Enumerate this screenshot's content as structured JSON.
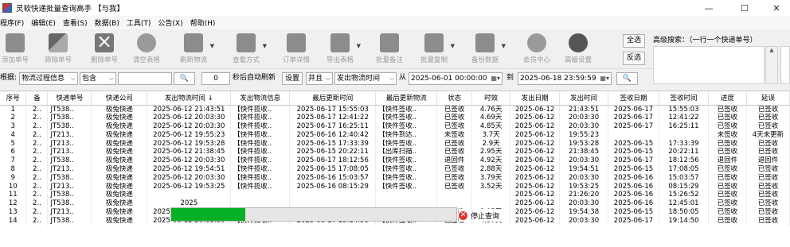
{
  "window": {
    "title": "灵软快递批量查询高手 【与我】",
    "min": "—",
    "max": "☐",
    "close": "✕"
  },
  "menu": [
    "程序(F)",
    "编辑(E)",
    "查看(S)",
    "数据(B)",
    "工具(T)",
    "公告(X)",
    "帮助(H)"
  ],
  "toolbar": {
    "add": "添加单号",
    "search_no": "筛除单号",
    "delete": "删除单号",
    "clear": "清空表格",
    "refresh": "刷新物流",
    "view": "查看方式",
    "detail": "订单详情",
    "export": "导出表格",
    "remark": "批量备注",
    "copy": "批量复制",
    "backup": "备份数据",
    "member": "会员中心",
    "settings": "高级设置"
  },
  "side": {
    "select_all": "全选",
    "invert": "反选"
  },
  "advanced": {
    "label": "高级搜索：（一行一个快递单号）",
    "scroll_up": "▲"
  },
  "filter": {
    "basis_label": "根据:",
    "basis": "物流过程信息",
    "mode": "包含",
    "keyword": "",
    "search_icon": "🔍",
    "interval": "0",
    "auto_label": "秒后自动刷新",
    "set": "设置",
    "logic": "并且",
    "time_field": "发出物流时间",
    "from": "从",
    "start": "2025-06-01 00:00:00",
    "to": "到",
    "end": "2025-06-18 23:59:59",
    "go_icon": "🔍"
  },
  "columns": [
    "序号",
    "备",
    "快递单号",
    "快递公司",
    "发出物流时间 ↓",
    "发出物流信息",
    "最后更新时间",
    "最后更新物流",
    "状态",
    "时效",
    "发出日期",
    "发出时间",
    "签收日期",
    "签收时间",
    "进度",
    "延误"
  ],
  "rows": [
    [
      "1",
      "2..",
      "JT538..",
      "极兔快递",
      "2025-06-12 21:43:51",
      "【快件揽收..",
      "2025-06-17 15:55:03",
      "【快件签收..",
      "已签收",
      "4.76天",
      "2025-06-12",
      "21:43:51",
      "2025-06-17",
      "15:55:03",
      "已签收",
      "已签收"
    ],
    [
      "2",
      "2..",
      "JT538..",
      "极兔快递",
      "2025-06-12 20:03:30",
      "【快件揽收..",
      "2025-06-17 12:41:22",
      "【快件签收..",
      "已签收",
      "4.69天",
      "2025-06-12",
      "20:03:30",
      "2025-06-17",
      "12:41:22",
      "已签收",
      "已签收"
    ],
    [
      "3",
      "2..",
      "JT538..",
      "极兔快递",
      "2025-06-12 20:03:30",
      "【快件揽收..",
      "2025-06-17 16:25:11",
      "【快件签收..",
      "已签收",
      "4.85天",
      "2025-06-12",
      "20:03:30",
      "2025-06-17",
      "16:25:11",
      "已签收",
      "已签收"
    ],
    [
      "4",
      "2..",
      "JT213..",
      "极兔快递",
      "2025-06-12 19:55:23",
      "【快件揽收..",
      "2025-06-16 12:40:42",
      "【快件到达..",
      "未签收",
      "3.7天",
      "2025-06-12",
      "19:55:23",
      "",
      "",
      "未签收",
      "4天未更新"
    ],
    [
      "5",
      "2..",
      "JT213..",
      "极兔快递",
      "2025-06-12 19:53:28",
      "【快件揽收..",
      "2025-06-15 17:33:39",
      "【快件签收..",
      "已签收",
      "2.9天",
      "2025-06-12",
      "19:53:28",
      "2025-06-15",
      "17:33:39",
      "已签收",
      "已签收"
    ],
    [
      "6",
      "2..",
      "JT213..",
      "极兔快递",
      "2025-06-12 21:38:45",
      "【快件揽收..",
      "2025-06-15 20:22:11",
      "【出库扫描..",
      "已签收",
      "2.95天",
      "2025-06-12",
      "21:38:45",
      "2025-06-15",
      "20:22:11",
      "已签收",
      "已签收"
    ],
    [
      "7",
      "2..",
      "JT538..",
      "极兔快递",
      "2025-06-12 20:03:30",
      "【快件揽收..",
      "2025-06-17 18:12:56",
      "【快件签收..",
      "退回件",
      "4.92天",
      "2025-06-12",
      "20:03:30",
      "2025-06-17",
      "18:12:56",
      "退回件",
      "退回件"
    ],
    [
      "8",
      "2..",
      "JT213..",
      "极兔快递",
      "2025-06-12 19:54:51",
      "【快件揽收..",
      "2025-06-15 17:08:05",
      "【快件签收..",
      "已签收",
      "2.88天",
      "2025-06-12",
      "19:54:51",
      "2025-06-15",
      "17:08:05",
      "已签收",
      "已签收"
    ],
    [
      "9",
      "2..",
      "JT538..",
      "极兔快递",
      "2025-06-12 20:03:30",
      "【快件揽收..",
      "2025-06-16 15:03:57",
      "【快件签收..",
      "已签收",
      "3.79天",
      "2025-06-12",
      "20:03:30",
      "2025-06-16",
      "15:03:57",
      "已签收",
      "已签收"
    ],
    [
      "10",
      "2..",
      "JT213..",
      "极兔快递",
      "2025-06-12 19:53:25",
      "【快件揽收..",
      "2025-06-16 08:15:29",
      "【快件签收..",
      "已签收",
      "3.52天",
      "2025-06-12",
      "19:53:25",
      "2025-06-16",
      "08:15:29",
      "已签收",
      "已签收"
    ],
    [
      "11",
      "2..",
      "JT538..",
      "极兔快递",
      "",
      "",
      "",
      "",
      "",
      "",
      "2025-06-12",
      "21:26:20",
      "2025-06-16",
      "15:26:52",
      "已签收",
      "已签收"
    ],
    [
      "12",
      "2..",
      "JT538..",
      "极兔快递",
      "2025",
      "",
      "",
      "",
      "",
      "",
      "2025-06-12",
      "20:03:30",
      "2025-06-16",
      "12:45:01",
      "已签收",
      "已签收"
    ],
    [
      "13",
      "2..",
      "JT213..",
      "极兔快递",
      "2025-06-12 19:54:38",
      "【快件揽收..",
      "2025-06-15 18:50:05",
      "【出库扫描..",
      "已签收",
      "2.95天",
      "2025-06-12",
      "19:54:38",
      "2025-06-15",
      "18:50:05",
      "已签收",
      "已签收"
    ],
    [
      "14",
      "2..",
      "JT538..",
      "极兔快递",
      "2025-06-12 20:03:30",
      "【快件揽收..",
      "2025-06-17 19:14:50",
      "【快件签收..",
      "已签收",
      "4.97天",
      "2025-06-12",
      "20:03:30",
      "2025-06-17",
      "19:14:50",
      "已签收",
      "已签收"
    ]
  ],
  "progress": {
    "value": 0.26,
    "stop_label": "停止查询",
    "stop_icon": "✕"
  }
}
